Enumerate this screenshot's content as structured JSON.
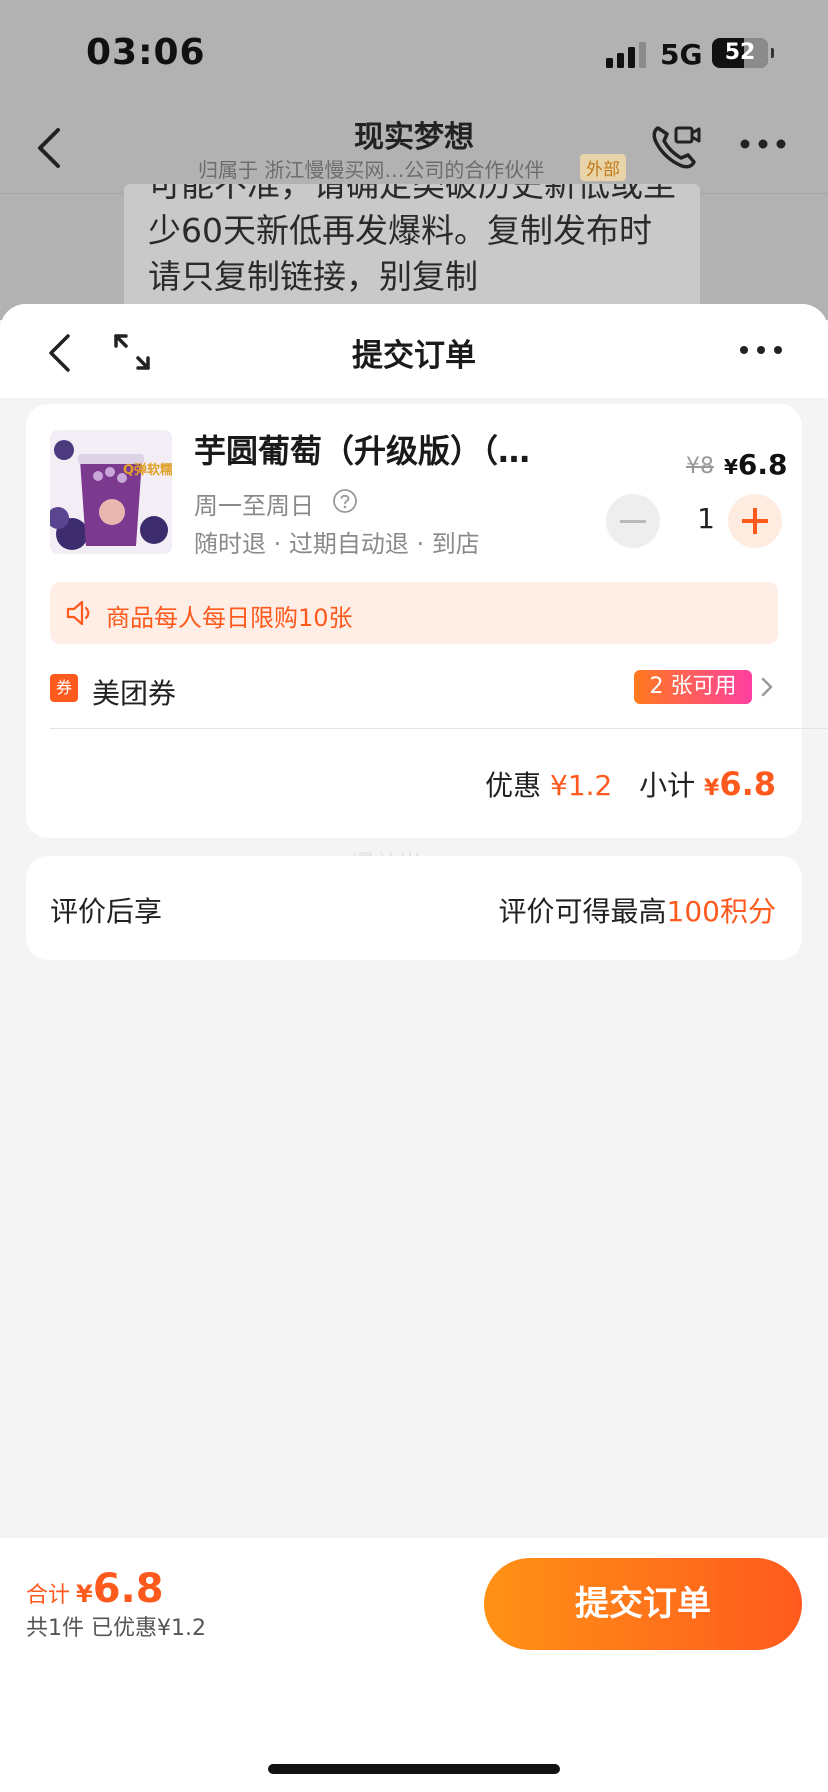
{
  "status_bar": {
    "time": "03:06",
    "network": "5G",
    "battery": "52"
  },
  "chat": {
    "title": "现实梦想",
    "subtitle": "归属于 浙江慢慢买网…公司的合作伙伴",
    "external_tag": "外部",
    "bubble_text": "可能不准，请确定类破历史新低或至少60天新低再发爆料。复制发布时请只复制链接，别复制"
  },
  "sheet": {
    "title": "提交订单",
    "product": {
      "name": "芋圆葡萄（升级版）（…",
      "valid_days": "周一至周日",
      "tags": "随时退 · 过期自动退 · 到店",
      "original_price": "¥8",
      "price_symbol": "¥",
      "price_amount": "6.8",
      "quantity": "1",
      "thumb_label": "Q弹软糯"
    },
    "limit_notice": "商品每人每日限购10张",
    "coupon": {
      "icon_text": "券",
      "label": "美团券",
      "badge": "2 张可用"
    },
    "subtotal": {
      "discount_label": "优惠",
      "discount_value": "¥1.2",
      "subtotal_label": "小计",
      "subtotal_symbol": "¥",
      "subtotal_amount": "6.8"
    },
    "watermark": "爆单光",
    "review": {
      "left": "评价后享",
      "right_prefix": "评价可得最高",
      "right_highlight": "100积分"
    }
  },
  "bottom_bar": {
    "total_label": "合计",
    "total_symbol": "¥",
    "total_amount": "6.8",
    "summary": "共1件  已优惠¥1.2",
    "submit_label": "提交订单"
  },
  "colors": {
    "accent": "#ff5a1e",
    "banner_bg": "#ffeee6",
    "page_bg": "#f4f4f4"
  }
}
